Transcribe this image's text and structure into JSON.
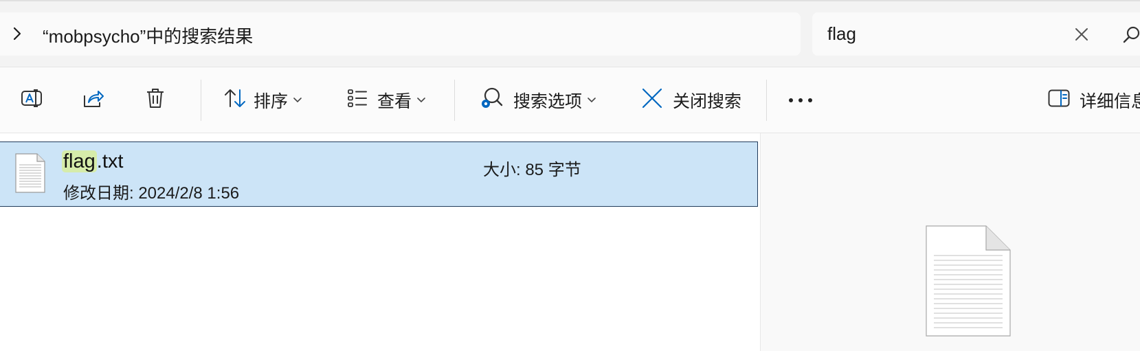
{
  "address": {
    "breadcrumb": "“mobpsycho”中的搜索结果"
  },
  "search": {
    "value": "flag"
  },
  "toolbar": {
    "sort_label": "排序",
    "view_label": "查看",
    "search_options_label": "搜索选项",
    "close_search_label": "关闭搜索",
    "details_label": "详细信息"
  },
  "icons": {
    "rename": "rename-icon",
    "share": "share-icon",
    "delete": "trash-icon",
    "sort": "sort-arrows-icon",
    "view": "view-list-icon",
    "search_options": "search-options-icon",
    "close_search": "close-x-icon",
    "more": "more-dots-icon",
    "details": "details-pane-icon"
  },
  "colors": {
    "accent": "#0067c0",
    "selection_bg": "#cce4f7",
    "highlight": "#d6ecaa"
  },
  "results": [
    {
      "name_match": "flag",
      "name_rest": ".txt",
      "modified": "修改日期: 2024/2/8 1:56",
      "size": "大小: 85 字节"
    }
  ]
}
